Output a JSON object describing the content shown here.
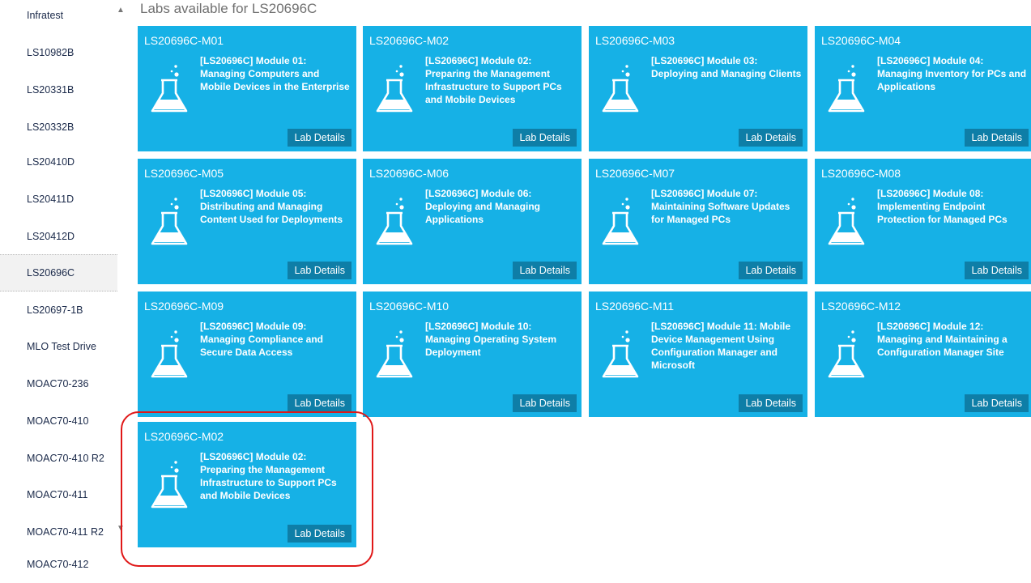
{
  "sidebar": {
    "items": [
      {
        "label": "Infratest"
      },
      {
        "label": "LS10982B"
      },
      {
        "label": "LS20331B"
      },
      {
        "label": "LS20332B"
      },
      {
        "label": "LS20410D"
      },
      {
        "label": "LS20411D"
      },
      {
        "label": "LS20412D"
      },
      {
        "label": "LS20696C",
        "active": true
      },
      {
        "label": "LS20697-1B"
      },
      {
        "label": "MLO Test Drive"
      },
      {
        "label": "MOAC70-236"
      },
      {
        "label": "MOAC70-410"
      },
      {
        "label": "MOAC70-410 R2"
      },
      {
        "label": "MOAC70-411"
      },
      {
        "label": "MOAC70-411 R2"
      },
      {
        "label": "MOAC70-412"
      }
    ],
    "scroll_up_icon": "chevron-up-icon",
    "scroll_down_icon": "chevron-down-icon"
  },
  "main": {
    "title": "Labs available for LS20696C",
    "lab_button_label": "Lab Details",
    "tile_icon": "flask-icon",
    "tiles": [
      {
        "id": "LS20696C-M01",
        "desc": "[LS20696C] Module 01: Managing Computers and Mobile Devices in the Enterprise"
      },
      {
        "id": "LS20696C-M02",
        "desc": "[LS20696C] Module 02: Preparing the Management Infrastructure to Support PCs and Mobile Devices"
      },
      {
        "id": "LS20696C-M03",
        "desc": "[LS20696C] Module 03: Deploying and Managing Clients"
      },
      {
        "id": "LS20696C-M04",
        "desc": "[LS20696C] Module 04: Managing Inventory for PCs and Applications"
      },
      {
        "id": "LS20696C-M05",
        "desc": "[LS20696C] Module 05: Distributing and Managing Content Used for Deployments"
      },
      {
        "id": "LS20696C-M06",
        "desc": "[LS20696C] Module 06: Deploying and Managing Applications"
      },
      {
        "id": "LS20696C-M07",
        "desc": "[LS20696C] Module 07: Maintaining Software Updates for Managed PCs"
      },
      {
        "id": "LS20696C-M08",
        "desc": "[LS20696C] Module 08: Implementing Endpoint Protection for Managed PCs"
      },
      {
        "id": "LS20696C-M09",
        "desc": "[LS20696C] Module 09: Managing Compliance and Secure Data Access"
      },
      {
        "id": "LS20696C-M10",
        "desc": "[LS20696C] Module 10: Managing Operating System Deployment"
      },
      {
        "id": "LS20696C-M11",
        "desc": "[LS20696C] Module 11: Mobile Device Management Using Configuration Manager and Microsoft"
      },
      {
        "id": "LS20696C-M12",
        "desc": "[LS20696C] Module 12: Managing and Maintaining a Configuration Manager Site"
      },
      {
        "id": "LS20696C-M02",
        "desc": "[LS20696C] Module 02: Preparing the Management Infrastructure to Support PCs and Mobile Devices"
      }
    ]
  },
  "colors": {
    "tile_bg": "#16b1e6",
    "button_bg": "#0e7ea7",
    "highlight": "#e01818"
  }
}
